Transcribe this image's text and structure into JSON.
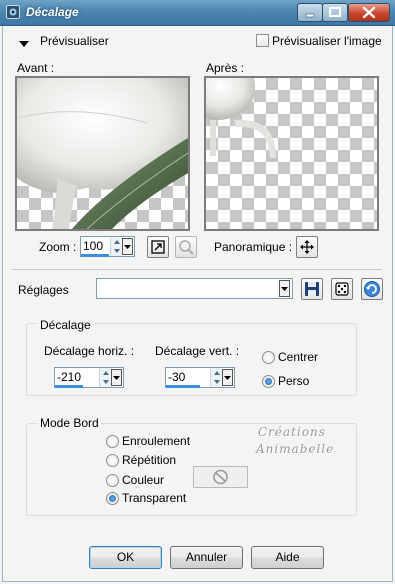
{
  "window": {
    "title": "Décalage"
  },
  "preview": {
    "section_label": "Prévisualiser",
    "preview_image_label": "Prévisualiser l'image",
    "preview_image_checked": false,
    "before_label": "Avant :",
    "after_label": "Après :",
    "zoom_label": "Zoom :",
    "zoom_value": "100",
    "pan_label": "Panoramique :"
  },
  "settings": {
    "label": "Réglages",
    "preset_value": ""
  },
  "offset": {
    "group_label": "Décalage",
    "horiz_label": "Décalage horiz. :",
    "horiz_value": "-210",
    "vert_label": "Décalage vert. :",
    "vert_value": "-30",
    "options": [
      "Centrer",
      "Perso"
    ],
    "selected": "Perso"
  },
  "edge": {
    "group_label": "Mode Bord",
    "options": [
      "Enroulement",
      "Répétition",
      "Couleur",
      "Transparent"
    ],
    "selected": "Transparent"
  },
  "watermark": {
    "line1": "Créations",
    "line2": "Animabelle"
  },
  "buttons": {
    "ok": "OK",
    "cancel": "Annuler",
    "help": "Aide"
  },
  "colors": {
    "accent": "#3a8fe0",
    "titlebar": "#4d86b1"
  }
}
